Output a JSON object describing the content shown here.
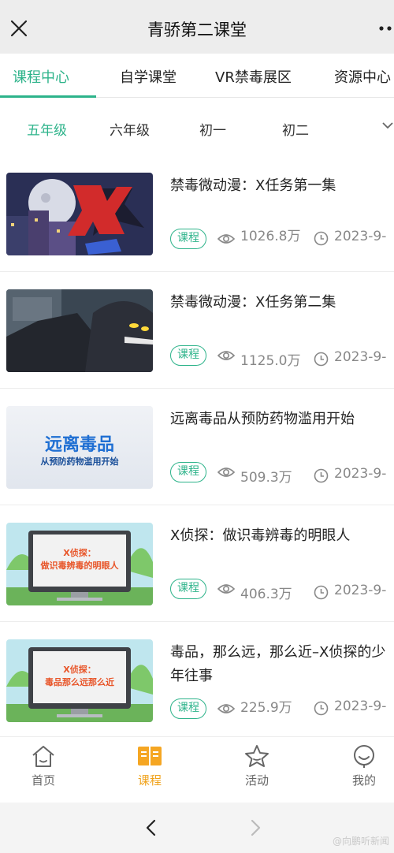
{
  "app": {
    "title": "青骄第二课堂"
  },
  "tabs": [
    "课程中心",
    "自学课堂",
    "VR禁毒展区",
    "资源中心"
  ],
  "grades": [
    "五年级",
    "六年级",
    "初一",
    "初二"
  ],
  "courses": [
    {
      "title": "禁毒微动漫：X任务第一集",
      "badge": "课程",
      "views": "1026.8万",
      "date": "2023-9-"
    },
    {
      "title": "禁毒微动漫：X任务第二集",
      "badge": "课程",
      "views": "1125.0万",
      "date": "2023-9-"
    },
    {
      "title": "远离毒品从预防药物滥用开始",
      "badge": "课程",
      "views": "509.3万",
      "date": "2023-9-"
    },
    {
      "title": "X侦探：做识毒辨毒的明眼人",
      "badge": "课程",
      "views": "406.3万",
      "date": "2023-9-"
    },
    {
      "title": "毒品，那么远，那么近–X侦探的少年往事",
      "badge": "课程",
      "views": "225.9万",
      "date": "2023-9-"
    }
  ],
  "thumbnails": [
    {
      "text": ""
    },
    {
      "text": ""
    },
    {
      "text_line1": "远离毒品",
      "text_line2": "从预防药物滥用开始"
    },
    {
      "text_line1": "X侦探：",
      "text_line2": "做识毒辨毒的明眼人"
    },
    {
      "text_line1": "X侦探：",
      "text_line2": "毒品那么远那么近"
    }
  ],
  "bottom_nav": [
    {
      "label": "首页",
      "icon": "home-icon"
    },
    {
      "label": "课程",
      "icon": "book-icon"
    },
    {
      "label": "活动",
      "icon": "star-icon"
    },
    {
      "label": "我的",
      "icon": "smile-icon"
    }
  ],
  "watermark": "@向鹏听新闻",
  "colors": {
    "accent": "#2db38a",
    "nav_active": "#f0a21a",
    "muted": "#888888"
  }
}
